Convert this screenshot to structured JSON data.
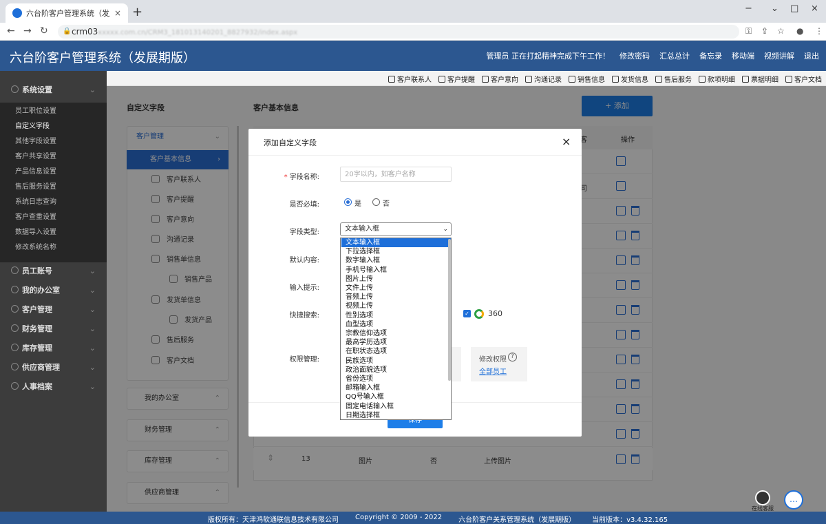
{
  "browser": {
    "tab_title": "六台阶客户管理系统（发展期版）",
    "tab_close": "×",
    "new_tab": "+",
    "url_visible": "crm03",
    "url_blurred": "xxxxx.com.cn/CRM3_181013140201_8827932/index.aspx",
    "win_min": "−",
    "win_max": "□",
    "win_close": "×",
    "nav_back": "←",
    "nav_forward": "→",
    "nav_reload": "↻"
  },
  "header": {
    "title": "六台阶客户管理系统（发展期版）",
    "status": "管理员 正在打起精神完成下午工作！",
    "links": [
      "修改密码",
      "汇总总计",
      "备忘录",
      "移动端",
      "视频讲解",
      "退出"
    ]
  },
  "sidebar": {
    "group_settings": "系统设置",
    "items": [
      "员工职位设置",
      "自定义字段",
      "其他字段设置",
      "客户共享设置",
      "产品信息设置",
      "售后服务设置",
      "系统日志查询",
      "客户查重设置",
      "数据导入设置",
      "修改系统名称"
    ],
    "groups": [
      "员工账号",
      "我的办公室",
      "客户管理",
      "财务管理",
      "库存管理",
      "供应商管理",
      "人事档案"
    ]
  },
  "toolbar": [
    "客户联系人",
    "客户提醒",
    "客户意向",
    "沟通记录",
    "销售信息",
    "发货信息",
    "售后服务",
    "款项明细",
    "票据明细",
    "客户文档"
  ],
  "content": {
    "left_title": "自定义字段",
    "right_title": "客户基本信息",
    "add_button": "+ 添加",
    "leftnav": {
      "customer_mgmt": "客户管理",
      "active": "客户基本信息",
      "subs": [
        "客户联系人",
        "客户提醒",
        "客户意向",
        "沟通记录",
        "销售单信息",
        "销售产品",
        "发货单信息",
        "发货产品",
        "售后服务",
        "客户文档"
      ],
      "groups": [
        "我的办公室",
        "财务管理",
        "库存管理",
        "供应商管理"
      ]
    },
    "table": {
      "col_partial": "客",
      "col_op": "操作",
      "row_partial": "司",
      "row13": {
        "index": "13",
        "name": "图片",
        "required": "否",
        "type": "上传图片"
      }
    }
  },
  "dialog": {
    "title": "添加自定义字段",
    "close": "×",
    "name_label": "字段名称:",
    "name_placeholder": "20字以内，如客户名称",
    "required_label": "是否必填:",
    "yes": "是",
    "no": "否",
    "type_label": "字段类型:",
    "type_selected": "文本输入框",
    "type_options": [
      "文本输入框",
      "下拉选择框",
      "数字输入框",
      "手机号输入框",
      "图片上传",
      "文件上传",
      "音频上传",
      "视频上传",
      "性别选项",
      "血型选项",
      "宗教信仰选项",
      "最高学历选项",
      "在职状态选项",
      "民族选项",
      "政治面貌选项",
      "省份选项",
      "邮箱输入框",
      "QQ号输入框",
      "固定电话输入框",
      "日期选择框"
    ],
    "default_label": "默认内容:",
    "hint_label": "输入提示:",
    "search_label": "快捷搜索:",
    "search_engine": "360",
    "perm_label": "权限管理:",
    "perm_title": "修改权限",
    "perm_help": "?",
    "perm_link": "全部员工",
    "save": "保存"
  },
  "footer": {
    "copyright_owner": "版权所有：天津鸿软通联信息技术有限公司",
    "copyright_years": "Copyright © 2009 - 2022",
    "product": "六台阶客户关系管理系统（发展期版）",
    "version": "当前版本：v3.4.32.165"
  },
  "service": {
    "label": "在线客服",
    "chat_icon": "…"
  },
  "colors": {
    "header": "#2c5790",
    "accent": "#1e7ee8",
    "sidebar": "#3c3c3c",
    "sidebar_sub": "#262626"
  }
}
